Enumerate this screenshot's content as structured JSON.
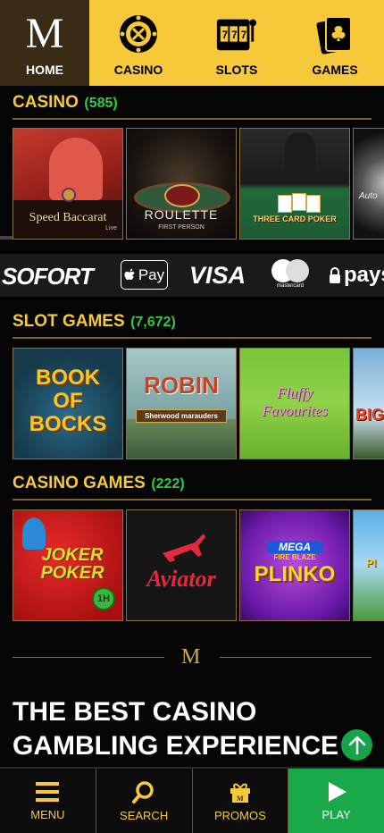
{
  "topnav": {
    "home": {
      "logo": "M",
      "label": "HOME"
    },
    "items": [
      {
        "label": "CASINO",
        "icon": "roulette-wheel-icon"
      },
      {
        "label": "SLOTS",
        "icon": "slot-machine-icon"
      },
      {
        "label": "GAMES",
        "icon": "playing-cards-icon"
      }
    ]
  },
  "sections": {
    "casino": {
      "title": "CASINO",
      "count": "(585)",
      "tiles": [
        "Speed Baccarat",
        "Live",
        "ROULETTE",
        "FIRST PERSON",
        "THREE CARD POKER",
        "Auto"
      ]
    },
    "slots": {
      "title": "SLOT GAMES",
      "count": "(7,672)",
      "tiles": [
        "BOOK OF BOCKS",
        "ROBIN",
        "Sherwood marauders",
        "Fluffy Favourites",
        "BIG"
      ]
    },
    "casino_games": {
      "title": "CASINO GAMES",
      "count": "(222)",
      "tiles": [
        "JOKER POKER",
        "1H",
        "Aviator",
        "MEGA",
        "FIRE BLAZE",
        "PLINKO",
        "PI"
      ]
    }
  },
  "payments": [
    "SOFORT",
    "Pay",
    "VISA",
    "mastercard",
    "pays"
  ],
  "divider_logo": "M",
  "hero": {
    "line1": "THE BEST CASINO",
    "line2": "GAMBLING EXPERIENCE"
  },
  "bottomnav": [
    {
      "label": "MENU",
      "icon": "menu-icon"
    },
    {
      "label": "SEARCH",
      "icon": "search-icon"
    },
    {
      "label": "PROMOS",
      "icon": "gift-icon"
    },
    {
      "label": "PLAY",
      "icon": "play-icon"
    }
  ],
  "colors": {
    "accent": "#f6c93a",
    "count_green": "#2ecc40",
    "play_green": "#19a84a",
    "nav_dark": "#3a2b15"
  }
}
